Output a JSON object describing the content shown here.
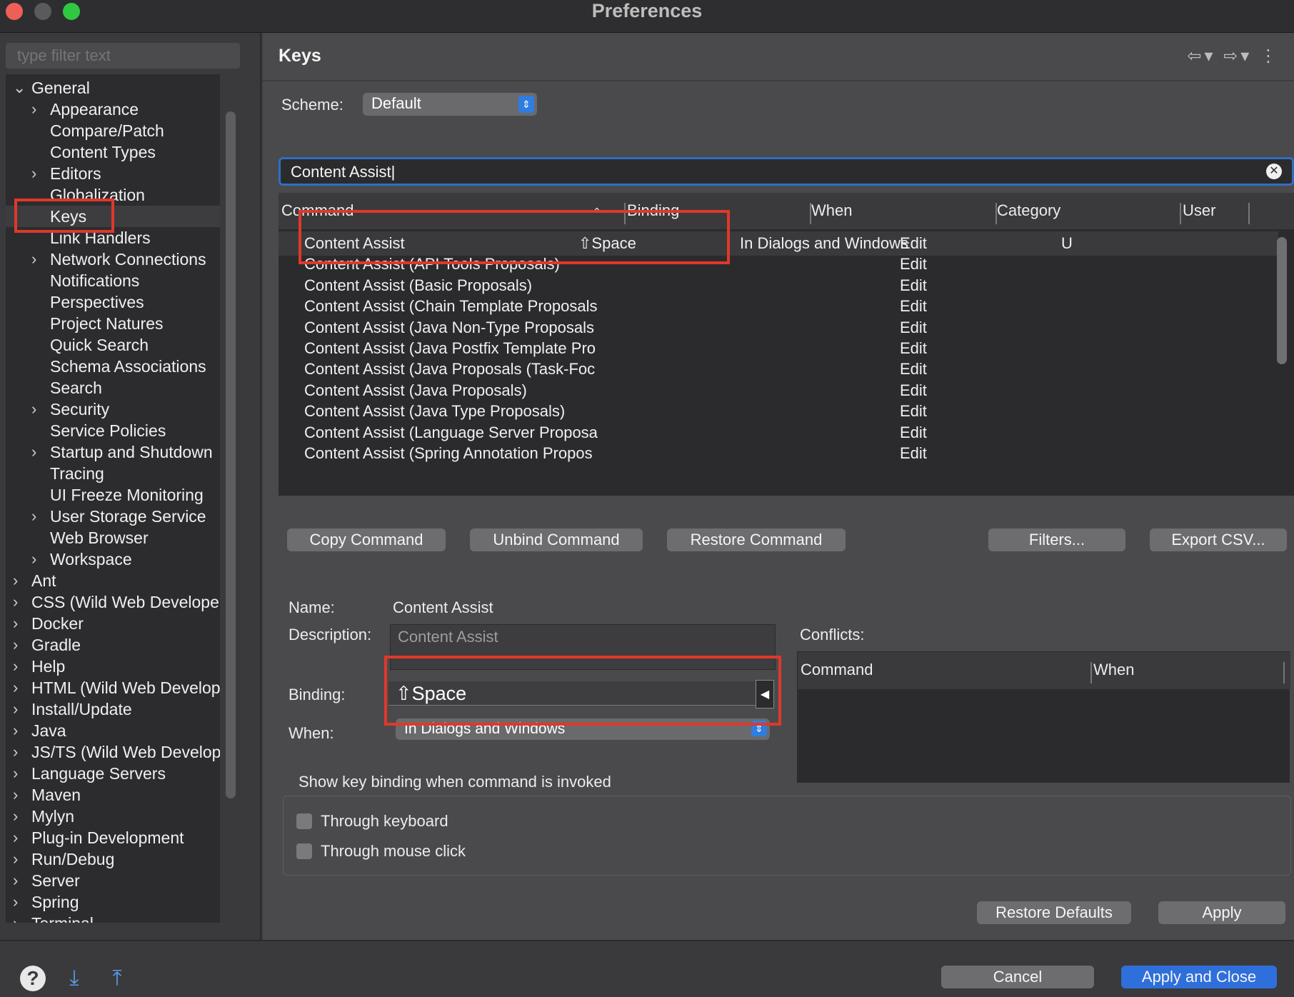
{
  "window": {
    "title": "Preferences"
  },
  "sidebar": {
    "filter_placeholder": "type filter text",
    "tree": [
      {
        "label": "General",
        "expander": "open"
      },
      {
        "label": "Appearance",
        "expander": "closed"
      },
      {
        "label": "Compare/Patch",
        "expander": "none"
      },
      {
        "label": "Content Types",
        "expander": "none"
      },
      {
        "label": "Editors",
        "expander": "closed"
      },
      {
        "label": "Globalization",
        "expander": "none"
      },
      {
        "label": "Keys",
        "expander": "none"
      },
      {
        "label": "Link Handlers",
        "expander": "none"
      },
      {
        "label": "Network Connections",
        "expander": "closed"
      },
      {
        "label": "Notifications",
        "expander": "none"
      },
      {
        "label": "Perspectives",
        "expander": "none"
      },
      {
        "label": "Project Natures",
        "expander": "none"
      },
      {
        "label": "Quick Search",
        "expander": "none"
      },
      {
        "label": "Schema Associations",
        "expander": "none"
      },
      {
        "label": "Search",
        "expander": "none"
      },
      {
        "label": "Security",
        "expander": "closed"
      },
      {
        "label": "Service Policies",
        "expander": "none"
      },
      {
        "label": "Startup and Shutdown",
        "expander": "closed"
      },
      {
        "label": "Tracing",
        "expander": "none"
      },
      {
        "label": "UI Freeze Monitoring",
        "expander": "none"
      },
      {
        "label": "User Storage Service",
        "expander": "closed"
      },
      {
        "label": "Web Browser",
        "expander": "none"
      },
      {
        "label": "Workspace",
        "expander": "closed"
      },
      {
        "label": "Ant",
        "expander": "closed"
      },
      {
        "label": "CSS (Wild Web Develope",
        "expander": "closed"
      },
      {
        "label": "Docker",
        "expander": "closed"
      },
      {
        "label": "Gradle",
        "expander": "closed"
      },
      {
        "label": "Help",
        "expander": "closed"
      },
      {
        "label": "HTML (Wild Web Develop",
        "expander": "closed"
      },
      {
        "label": "Install/Update",
        "expander": "closed"
      },
      {
        "label": "Java",
        "expander": "closed"
      },
      {
        "label": "JS/TS (Wild Web Develop",
        "expander": "closed"
      },
      {
        "label": "Language Servers",
        "expander": "closed"
      },
      {
        "label": "Maven",
        "expander": "closed"
      },
      {
        "label": "Mylyn",
        "expander": "closed"
      },
      {
        "label": "Plug-in Development",
        "expander": "closed"
      },
      {
        "label": "Run/Debug",
        "expander": "closed"
      },
      {
        "label": "Server",
        "expander": "closed"
      },
      {
        "label": "Spring",
        "expander": "closed"
      },
      {
        "label": "Terminal",
        "expander": "closed"
      }
    ],
    "selected": "Keys"
  },
  "main": {
    "title": "Keys",
    "scheme_label": "Scheme:",
    "scheme_value": "Default",
    "search_value": "Content Assist",
    "columns": [
      "Command",
      "Binding",
      "When",
      "Category",
      "User"
    ],
    "rows": [
      {
        "command": "Content Assist",
        "binding": "⇧Space",
        "when": "In Dialogs and Windows",
        "category": "Edit",
        "user": "U"
      },
      {
        "command": "Content Assist (API Tools Proposals)",
        "binding": "",
        "when": "",
        "category": "Edit",
        "user": ""
      },
      {
        "command": "Content Assist (Basic Proposals)",
        "binding": "",
        "when": "",
        "category": "Edit",
        "user": ""
      },
      {
        "command": "Content Assist (Chain Template Proposals",
        "binding": "",
        "when": "",
        "category": "Edit",
        "user": ""
      },
      {
        "command": "Content Assist (Java Non-Type Proposals",
        "binding": "",
        "when": "",
        "category": "Edit",
        "user": ""
      },
      {
        "command": "Content Assist (Java Postfix Template Pro",
        "binding": "",
        "when": "",
        "category": "Edit",
        "user": ""
      },
      {
        "command": "Content Assist (Java Proposals (Task-Foc",
        "binding": "",
        "when": "",
        "category": "Edit",
        "user": ""
      },
      {
        "command": "Content Assist (Java Proposals)",
        "binding": "",
        "when": "",
        "category": "Edit",
        "user": ""
      },
      {
        "command": "Content Assist (Java Type Proposals)",
        "binding": "",
        "when": "",
        "category": "Edit",
        "user": ""
      },
      {
        "command": "Content Assist (Language Server Proposa",
        "binding": "",
        "when": "",
        "category": "Edit",
        "user": ""
      },
      {
        "command": "Content Assist (Spring Annotation Propos",
        "binding": "",
        "when": "",
        "category": "Edit",
        "user": ""
      }
    ],
    "buttons": {
      "copy": "Copy Command",
      "unbind": "Unbind Command",
      "restore": "Restore Command",
      "filters": "Filters...",
      "export": "Export CSV..."
    },
    "details": {
      "name_label": "Name:",
      "name_value": "Content Assist",
      "description_label": "Description:",
      "description_value": "Content Assist",
      "binding_label": "Binding:",
      "binding_value": "⇧Space",
      "when_label": "When:",
      "when_value": "In Dialogs and Windows",
      "conflicts_label": "Conflicts:",
      "conflict_columns": [
        "Command",
        "When"
      ]
    },
    "show_binding": {
      "label": "Show key binding when command is invoked",
      "keyboard": "Through keyboard",
      "mouse": "Through mouse click"
    },
    "restore_defaults": "Restore Defaults",
    "apply": "Apply"
  },
  "footer": {
    "cancel": "Cancel",
    "apply_close": "Apply and Close"
  },
  "colors": {
    "accent": "#2f6fdb",
    "highlight": "#e0382b"
  }
}
